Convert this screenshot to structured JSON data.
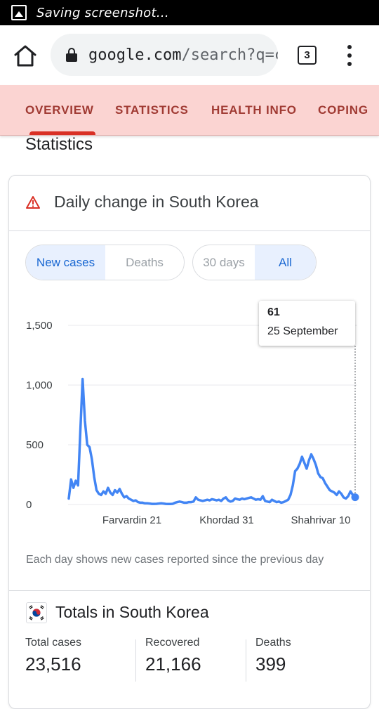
{
  "status_bar": {
    "text": "Saving screenshot..."
  },
  "browser": {
    "url_primary": "google.com",
    "url_secondary": "/search?q=c",
    "tab_count": "3"
  },
  "nav_tabs": [
    {
      "label": "OVERVIEW",
      "active": true
    },
    {
      "label": "STATISTICS",
      "active": false
    },
    {
      "label": "HEALTH INFO",
      "active": false
    },
    {
      "label": "COPING",
      "active": false
    }
  ],
  "section_title": "Statistics",
  "card": {
    "title": "Daily change in South Korea",
    "metric_toggle": {
      "options": [
        "New cases",
        "Deaths"
      ],
      "selected": "New cases"
    },
    "range_toggle": {
      "options": [
        "30 days",
        "All"
      ],
      "selected": "All"
    },
    "tooltip": {
      "value": "61",
      "date": "25 September"
    },
    "note": "Each day shows new cases reported since the previous day"
  },
  "chart_data": {
    "type": "line",
    "title": "",
    "xlabel": "",
    "ylabel": "",
    "ylim": [
      0,
      1500
    ],
    "y_ticks": [
      "0",
      "500",
      "1,000",
      "1,500"
    ],
    "x_tick_labels": [
      "Farvardin 21",
      "Khordad 31",
      "Shahrivar 10"
    ],
    "grid": "horizontal",
    "color": "#4285f4",
    "series": [
      {
        "values": [
          50,
          210,
          140,
          200,
          160,
          620,
          1050,
          700,
          500,
          480,
          380,
          230,
          120,
          90,
          80,
          110,
          90,
          140,
          100,
          80,
          120,
          100,
          130,
          90,
          60,
          70,
          50,
          40,
          30,
          35,
          20,
          15,
          15,
          10,
          10,
          8,
          5,
          5,
          6,
          8,
          10,
          8,
          5,
          4,
          4,
          6,
          15,
          20,
          25,
          20,
          15,
          15,
          20,
          20,
          25,
          60,
          40,
          35,
          30,
          35,
          40,
          35,
          45,
          40,
          35,
          40,
          30,
          50,
          60,
          35,
          25,
          30,
          50,
          45,
          40,
          50,
          45,
          50,
          55,
          60,
          50,
          40,
          45,
          40,
          70,
          30,
          25,
          20,
          40,
          30,
          20,
          25,
          15,
          20,
          30,
          40,
          80,
          160,
          280,
          300,
          340,
          400,
          350,
          300,
          370,
          420,
          380,
          330,
          260,
          230,
          220,
          180,
          150,
          120,
          110,
          100,
          80,
          110,
          90,
          60,
          50,
          70,
          110,
          80,
          61
        ]
      }
    ],
    "highlight": {
      "label": "25 September",
      "value": 61
    }
  },
  "totals": {
    "title": "Totals in South Korea",
    "stats": [
      {
        "label": "Total cases",
        "value": "23,516"
      },
      {
        "label": "Recovered",
        "value": "21,166"
      },
      {
        "label": "Deaths",
        "value": "399"
      }
    ]
  },
  "colors": {
    "nav_background": "#fbd4d2",
    "nav_text": "#a03a33",
    "nav_active_indicator": "#d93025",
    "toggle_selected_bg": "#e8f0fe",
    "toggle_selected_text": "#1967d2",
    "line": "#4285f4"
  }
}
